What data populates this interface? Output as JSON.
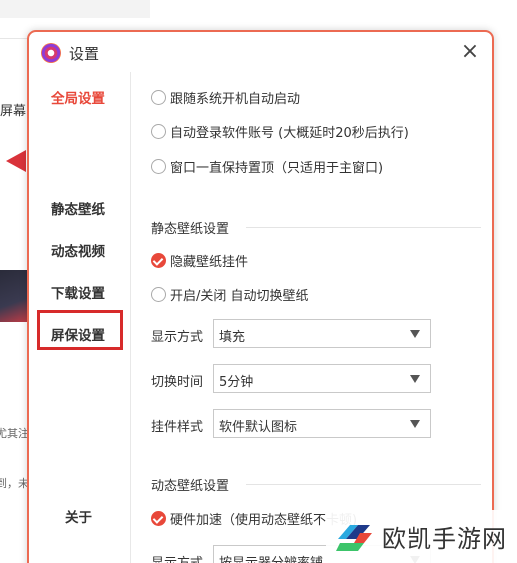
{
  "background": {
    "fragments": [
      "屏幕",
      "尤其注",
      "到，未"
    ]
  },
  "dialog": {
    "title": "设置",
    "close_label": "×"
  },
  "nav": {
    "items": [
      {
        "label": "全局设置",
        "active": true
      },
      {
        "label": "静态壁纸",
        "active": false
      },
      {
        "label": "动态视频",
        "active": false
      },
      {
        "label": "下载设置",
        "active": false
      },
      {
        "label": "屏保设置",
        "active": false,
        "highlighted": true
      },
      {
        "label": "关于",
        "active": false
      }
    ]
  },
  "global": {
    "options": [
      {
        "label": "跟随系统开机自动启动",
        "checked": false
      },
      {
        "label": "自动登录软件账号 (大概延时20秒后执行)",
        "checked": false
      },
      {
        "label": "窗口一直保持置顶（只适用于主窗口)",
        "checked": false
      }
    ]
  },
  "static_wallpaper": {
    "section_title": "静态壁纸设置",
    "options": [
      {
        "label": "隐藏壁纸挂件",
        "checked": true
      },
      {
        "label": "开启/关闭 自动切换壁纸",
        "checked": false
      }
    ],
    "fields": [
      {
        "label": "显示方式",
        "value": "填充"
      },
      {
        "label": "切换时间",
        "value": "5分钟"
      },
      {
        "label": "挂件样式",
        "value": "软件默认图标"
      }
    ]
  },
  "dynamic_wallpaper": {
    "section_title": "动态壁纸设置",
    "options": [
      {
        "label": "硬件加速（使用动态壁纸不卡顿)",
        "checked": true
      }
    ],
    "fields": [
      {
        "label": "显示方式",
        "value": "按显示器分辨率铺"
      }
    ]
  },
  "watermark": {
    "text": "欧凯手游网"
  },
  "colors": {
    "accent": "#e8483a",
    "dialog_border": "#ec6a52",
    "highlight_box": "#d72a2a"
  }
}
